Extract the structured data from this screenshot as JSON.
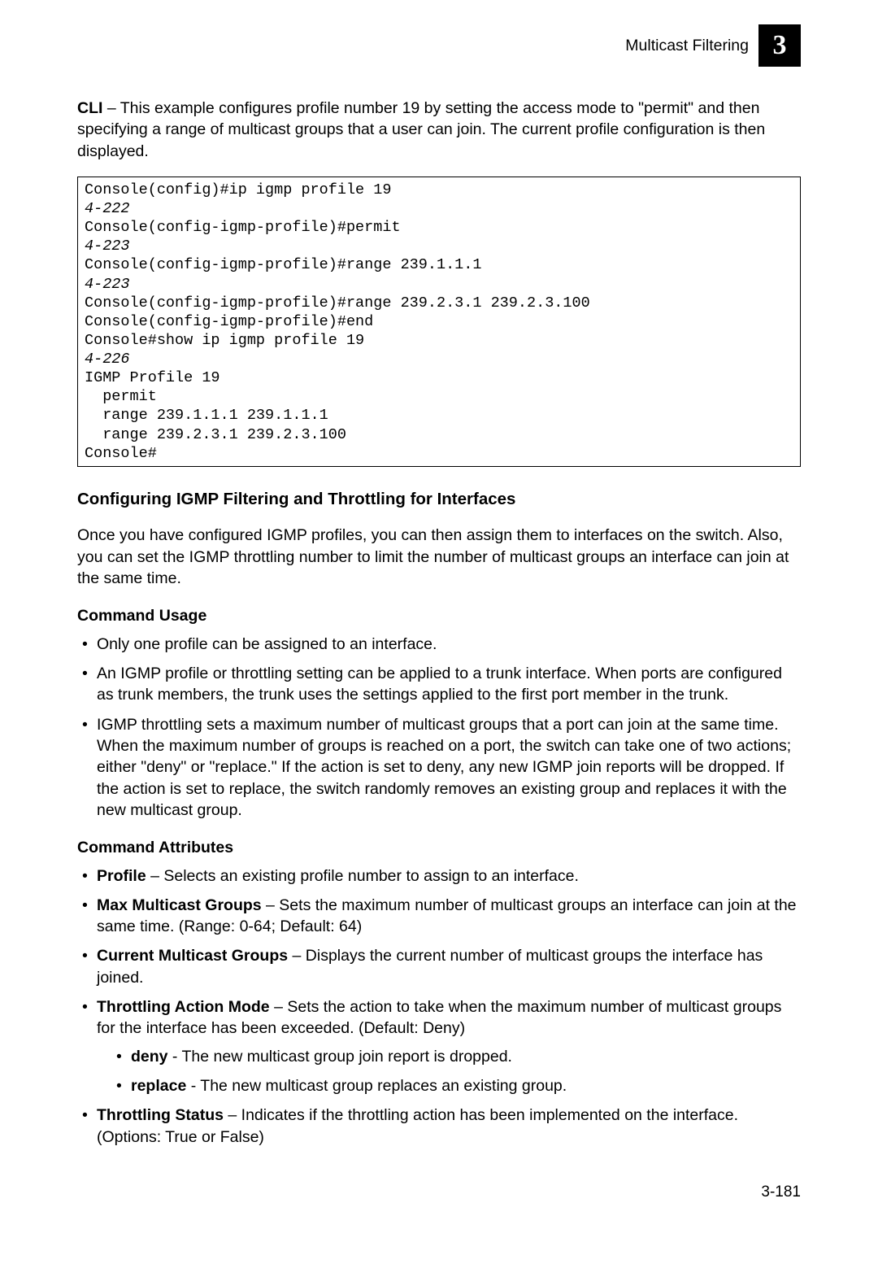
{
  "header": {
    "title": "Multicast Filtering",
    "chapter": "3"
  },
  "intro": {
    "cli_label": "CLI",
    "text": " – This example configures profile number 19 by setting the access mode to \"permit\" and then specifying a range of multicast groups that a user can join. The current profile configuration is then displayed."
  },
  "code": {
    "l1": "Console(config)#ip igmp profile 19",
    "l2": "4-222",
    "l3": "Console(config-igmp-profile)#permit",
    "l4": "4-223",
    "l5": "Console(config-igmp-profile)#range 239.1.1.1",
    "l6": "4-223",
    "l7": "Console(config-igmp-profile)#range 239.2.3.1 239.2.3.100",
    "l8": "Console(config-igmp-profile)#end",
    "l9": "Console#show ip igmp profile 19",
    "l10": "4-226",
    "l11": "IGMP Profile 19",
    "l12": "  permit",
    "l13": "  range 239.1.1.1 239.1.1.1",
    "l14": "  range 239.2.3.1 239.2.3.100",
    "l15": "Console#"
  },
  "section": {
    "heading": "Configuring IGMP Filtering and Throttling for Interfaces",
    "para": "Once you have configured IGMP profiles, you can then assign them to interfaces on the switch. Also, you can set the IGMP throttling number to limit the number of multicast groups an interface can join at the same time."
  },
  "usage": {
    "heading": "Command Usage",
    "b1": "Only one profile can be assigned to an interface.",
    "b2": "An IGMP profile or throttling setting can be applied to a trunk interface. When ports are configured as trunk members, the trunk uses the settings applied to the first port member in the trunk.",
    "b3": "IGMP throttling sets a maximum number of multicast groups that a port can join at the same time. When the maximum number of groups is reached on a port, the switch can take one of two actions; either \"deny\" or \"replace.\" If the action is set to deny, any new IGMP join reports will be dropped. If the action is set to replace, the switch randomly removes an existing group and replaces it with the new multicast group."
  },
  "attrs": {
    "heading": "Command Attributes",
    "b1": {
      "bold": "Profile",
      "rest": " – Selects an existing profile number to assign to an interface."
    },
    "b2": {
      "bold": "Max Multicast Groups",
      "rest": " – Sets the maximum number of multicast groups an interface can join at the same time. (Range: 0-64; Default: 64)"
    },
    "b3": {
      "bold": "Current Multicast Groups",
      "rest": " – Displays the current number of multicast groups the interface has joined."
    },
    "b4": {
      "bold": "Throttling Action Mode",
      "rest": " – Sets the action to take when the maximum number of multicast groups for the interface has been exceeded. (Default: Deny)"
    },
    "b4a": {
      "bold": "deny",
      "rest": " - The new multicast group join report is dropped."
    },
    "b4b": {
      "bold": "replace",
      "rest": " - The new multicast group replaces an existing group."
    },
    "b5": {
      "bold": "Throttling Status",
      "rest": " – Indicates if the throttling action has been implemented on the interface. (Options: True or False)"
    }
  },
  "page_number": "3-181"
}
